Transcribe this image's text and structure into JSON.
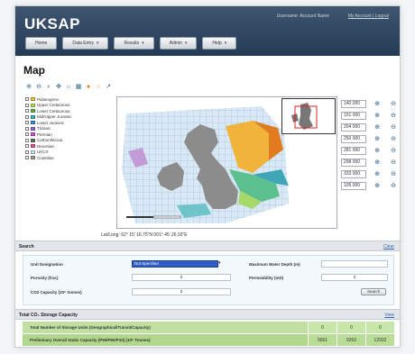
{
  "app": {
    "title": "UKSAP"
  },
  "header": {
    "user_text": "Username: Account Name",
    "logout_text": "My Account | Logout"
  },
  "nav": [
    {
      "label": "Home"
    },
    {
      "label": "Data Entry"
    },
    {
      "label": "Results"
    },
    {
      "label": "Admin"
    },
    {
      "label": "Help"
    }
  ],
  "page": {
    "title": "Map"
  },
  "toolbar": {
    "icons": [
      "zoom-in-icon",
      "zoom-out-icon",
      "zoom-box-icon",
      "pan-icon",
      "full-extent-icon",
      "layer-icon",
      "point-icon",
      "select-icon",
      "measure-icon"
    ]
  },
  "legend": [
    {
      "label": "Palaeogene",
      "color": "#e8c23a"
    },
    {
      "label": "Upper Cretaceous",
      "color": "#b6e05a"
    },
    {
      "label": "Lower Cretaceous",
      "color": "#5ab84a"
    },
    {
      "label": "Mid/Upper Jurassic",
      "color": "#3fb6b0"
    },
    {
      "label": "Lower Jurassic",
      "color": "#3b8fcf"
    },
    {
      "label": "Triassic",
      "color": "#8e6ad1"
    },
    {
      "label": "Permian",
      "color": "#d14fd1"
    },
    {
      "label": "Carboniferous",
      "color": "#6c6c6c"
    },
    {
      "label": "Devonian",
      "color": "#e05a8a"
    },
    {
      "label": "UKCS",
      "color": "#cfe3f2"
    },
    {
      "label": "Coastline",
      "color": "#9a9a9a"
    }
  ],
  "scales": [
    "140 000",
    "151 000",
    "204 000",
    "250 000",
    "281 000",
    "298 000",
    "333 000",
    "105 000"
  ],
  "coords": {
    "text": "Lat/Long: 62° 15' 16.75\"N 001° 45' 26.93\"E"
  },
  "search": {
    "title": "Search",
    "link": "Clear",
    "unit_designation_label": "Unit Designation",
    "unit_designation_value": "Not Specified",
    "max_depth_label": "Maximum Water Depth (m)",
    "max_depth_value": "",
    "porosity_label": "Porosity (frac)",
    "porosity_value": "0",
    "permeability_label": "Permeability (mD)",
    "permeability_value": "0",
    "co2_capacity_label": "CO2 Capacity (10⁶ tonnes)",
    "co2_capacity_value": "0",
    "search_button": "Search"
  },
  "capacity": {
    "title": "Total CO₂ Storage Capacity",
    "link": "View",
    "rows": [
      {
        "label": "Total Number of Storage Units (Geographical/Transit/Capacity)",
        "values": [
          "0",
          "0",
          "0"
        ]
      },
      {
        "label": "Preliminary Overall Static Capacity (P90/P50/P10) (10⁶ Tonnes)",
        "values": [
          "5651",
          "9263",
          "12932"
        ]
      }
    ]
  }
}
